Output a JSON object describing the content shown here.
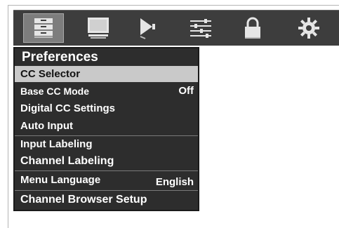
{
  "icon_bar": {
    "tabs": [
      {
        "icon": "preferences-icon",
        "active": true
      },
      {
        "icon": "monitor-icon",
        "active": false
      },
      {
        "icon": "speaker-icon",
        "active": false
      },
      {
        "icon": "equalizer-icon",
        "active": false
      },
      {
        "icon": "lock-icon",
        "active": false
      },
      {
        "icon": "gear-icon",
        "active": false
      }
    ]
  },
  "menu": {
    "title": "Preferences",
    "items": [
      {
        "label": "CC Selector",
        "value": "",
        "selected": true
      },
      {
        "label": "Base CC Mode",
        "value": "Off",
        "selected": false
      },
      {
        "label": "Digital CC Settings",
        "value": "",
        "selected": false
      },
      {
        "label": "Auto Input",
        "value": "",
        "selected": false
      },
      {
        "label": "Input Labeling",
        "value": "",
        "selected": false
      },
      {
        "label": "Channel Labeling",
        "value": "",
        "selected": false
      },
      {
        "label": "Menu Language",
        "value": "English",
        "selected": false
      },
      {
        "label": "Channel Browser Setup",
        "value": "",
        "selected": false
      }
    ]
  },
  "colors": {
    "menu_bg": "#2d2d2d",
    "selected_bg": "#c9c9c9",
    "icon_bar_bg": "#3d3d3d",
    "active_tab_bg": "#7d7d7d"
  }
}
